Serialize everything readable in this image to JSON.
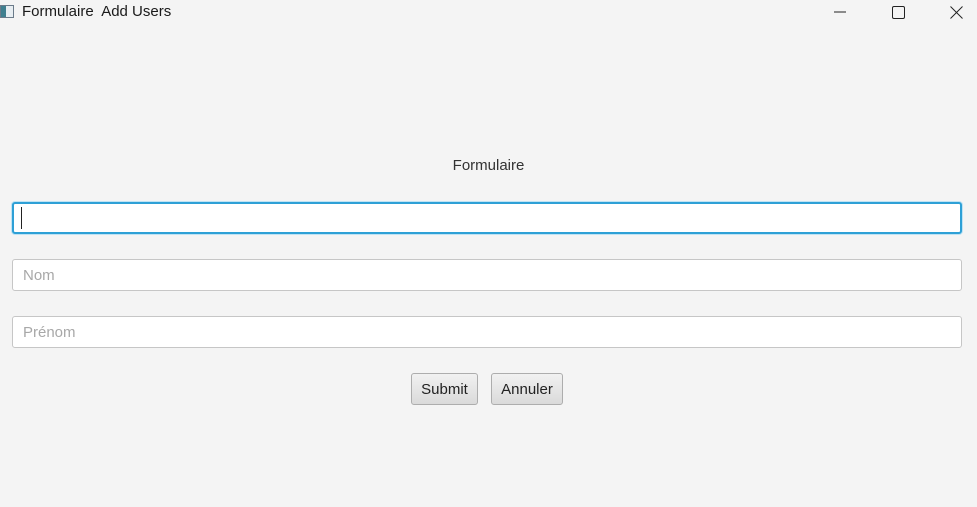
{
  "window": {
    "title": "Formulaire  Add Users",
    "icons": {
      "app": "app-window-icon",
      "minimize": "minimize-icon",
      "maximize": "maximize-icon",
      "close": "close-icon"
    }
  },
  "form": {
    "title": "Formulaire",
    "fields": [
      {
        "value": "",
        "placeholder": ""
      },
      {
        "value": "",
        "placeholder": "Nom"
      },
      {
        "value": "",
        "placeholder": "Prénom"
      }
    ],
    "submit_label": "Submit",
    "cancel_label": "Annuler"
  },
  "colors": {
    "background": "#f4f4f4",
    "focus_ring": "#2ea0d6"
  }
}
